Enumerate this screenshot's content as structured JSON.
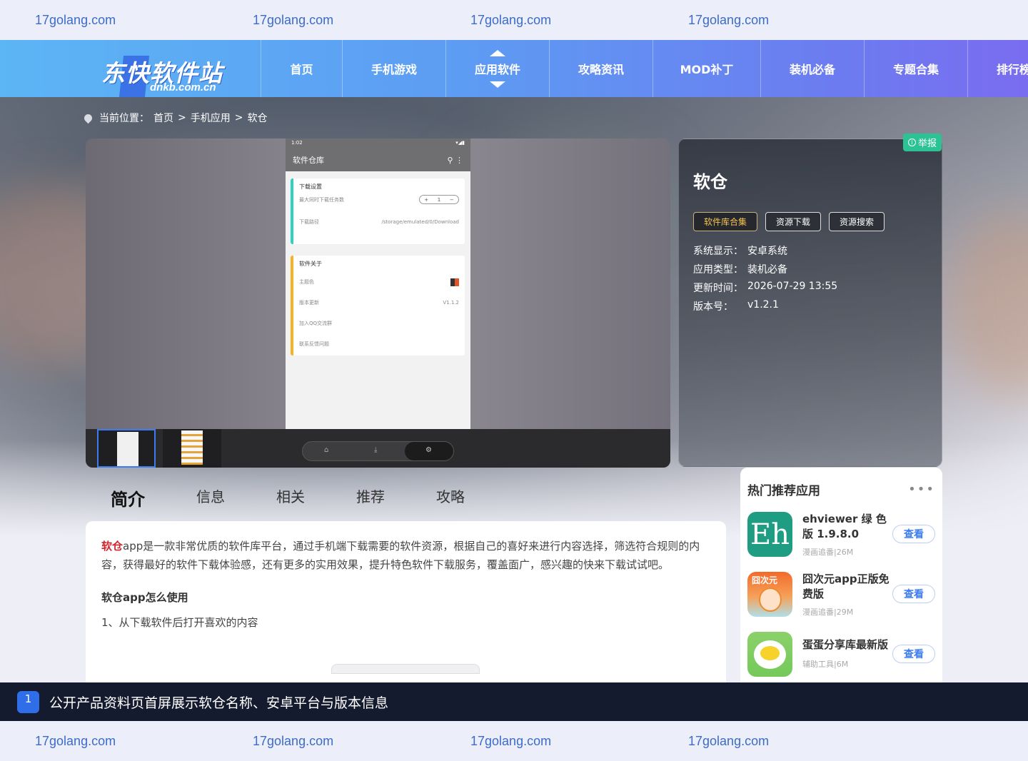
{
  "watermark": "17golang.com",
  "nav": {
    "logo_cn": "东快软件站",
    "logo_en": "dnkb.com.cn",
    "items": [
      "首页",
      "手机游戏",
      "应用软件",
      "攻略资讯",
      "MOD补丁",
      "装机必备",
      "专题合集",
      "排行榜"
    ],
    "active": "应用软件"
  },
  "breadcrumb": {
    "prefix": "当前位置：",
    "home": "首页",
    "sep": ">",
    "category": "手机应用",
    "current": "软仓"
  },
  "screenshot": {
    "status_time": "1:02",
    "appbar_title": "软件仓库",
    "card1_title": "下载设置",
    "card1_row1": "最大同时下载任务数",
    "stepper_plus": "+",
    "stepper_value": "1",
    "stepper_minus": "−",
    "card1_row2_label": "下载路径",
    "card1_row2_value": "/storage/emulated/0/Download",
    "card2_title": "软件关于",
    "card2_rows": [
      "主题色",
      "版本更新",
      "加入QQ交流群",
      "联系反馈问题"
    ],
    "version": "V1.1.2"
  },
  "info": {
    "report": "举报",
    "title": "软仓",
    "tags": [
      "软件库合集",
      "资源下载",
      "资源搜索"
    ],
    "meta": [
      {
        "k": "系统显示：",
        "v": "安卓系统"
      },
      {
        "k": "应用类型：",
        "v": "装机必备"
      },
      {
        "k": "更新时间：",
        "v": "2026-07-29 13:55"
      },
      {
        "k": "版本号：",
        "v": "v1.2.1"
      }
    ]
  },
  "tabs": [
    "简介",
    "信息",
    "相关",
    "推荐",
    "攻略"
  ],
  "content": {
    "lead_highlight": "软仓",
    "lead_text": "app是一款非常优质的软件库平台，通过手机端下载需要的软件资源，根据自己的喜好来进行内容选择，筛选符合规则的内容，获得最好的软件下载体验感，还有更多的实用效果，提升特色软件下载服务，覆盖面广，感兴趣的快来下载试试吧。",
    "heading": "软仓app怎么使用",
    "step1": "1、从下载软件后打开喜欢的内容"
  },
  "hot": {
    "title": "热门推荐应用",
    "more": "•••",
    "items": [
      {
        "name": "ehviewer 绿 色 版 1.9.8.0",
        "sub": "漫画追番|26M",
        "btn": "查看",
        "icon_text": "Eh",
        "icon_color": "#1f9d82"
      },
      {
        "name": "囧次元app正版免费版",
        "sub": "漫画追番|29M",
        "btn": "查看",
        "icon_text": "囧次元",
        "icon_color": "#f07a32"
      },
      {
        "name": "蛋蛋分享库最新版",
        "sub": "辅助工具|6M",
        "btn": "查看",
        "icon_text": "",
        "icon_color": "#7ccf5a"
      }
    ]
  },
  "caption": {
    "num": "1",
    "text": "公开产品资料页首屏展示软仓名称、安卓平台与版本信息"
  }
}
